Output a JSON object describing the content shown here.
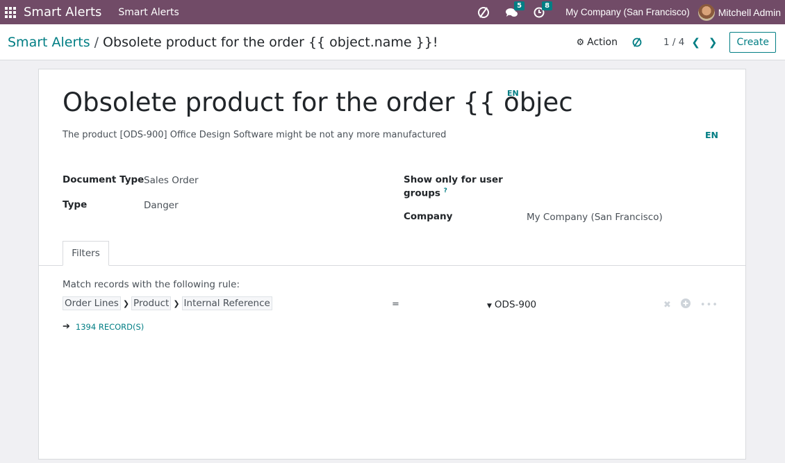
{
  "navbar": {
    "brand": "Smart Alerts",
    "menu_item": "Smart Alerts",
    "messages_count": "5",
    "activities_count": "8",
    "company": "My Company (San Francisco)",
    "user_name": "Mitchell Admin"
  },
  "control_panel": {
    "breadcrumb_parent": "Smart Alerts",
    "breadcrumb_separator": "/",
    "breadcrumb_current": "Obsolete product for the order {{ object.name }}!",
    "action_label": "Action",
    "pager": "1 / 4",
    "create_label": "Create"
  },
  "form": {
    "title": "Obsolete product for the order {{ objec",
    "title_lang": "EN",
    "description": "The product [ODS-900] Office Design Software might be not any more manufactured",
    "description_lang": "EN",
    "document_type_label": "Document Type",
    "document_type_value": "Sales Order",
    "type_label": "Type",
    "type_value": "Danger",
    "groups_label_line1": "Show only for user",
    "groups_label_line2": "groups",
    "groups_help": "?",
    "company_label": "Company",
    "company_value": "My Company (San Francisco)"
  },
  "tabs": [
    {
      "label": "Filters"
    }
  ],
  "filter": {
    "match_text": "Match records with the following rule:",
    "path": [
      "Order Lines",
      "Product",
      "Internal Reference"
    ],
    "operator": "=",
    "value": "ODS-900",
    "records_label": "1394 RECORD(S)"
  },
  "colors": {
    "navbar": "#714b67",
    "accent": "#017e84",
    "background": "#f0f0f3"
  }
}
